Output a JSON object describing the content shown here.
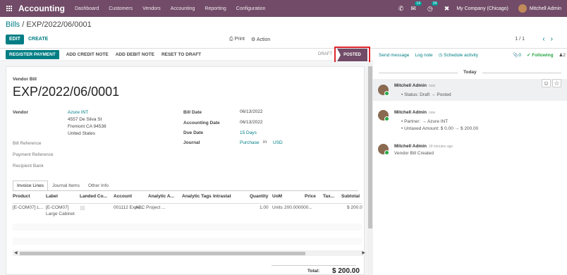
{
  "topbar": {
    "app_name": "Accounting",
    "menu": [
      "Dashboard",
      "Customers",
      "Vendors",
      "Accounting",
      "Reporting",
      "Configuration"
    ],
    "messages_count": "14",
    "activities_count": "34",
    "company": "My Company (Chicago)",
    "user": "Mitchell Admin"
  },
  "breadcrumb": {
    "parent": "Bills",
    "separator": " / ",
    "current": "EXP/2022/06/0001"
  },
  "control": {
    "edit_label": "EDIT",
    "create_label": "CREATE",
    "print_label": "Print",
    "action_label": "Action",
    "pager": "1 / 1"
  },
  "statusbar": {
    "buttons": [
      "REGISTER PAYMENT",
      "ADD CREDIT NOTE",
      "ADD DEBIT NOTE",
      "RESET TO DRAFT"
    ],
    "stage_draft": "DRAFT",
    "stage_posted": "POSTED"
  },
  "form": {
    "doc_type": "Vendor Bill",
    "doc_name": "EXP/2022/06/0001",
    "vendor_label": "Vendor",
    "vendor_name": "Azure INT",
    "vendor_address": [
      "4557 De Silva St",
      "Fremont CA 94538",
      "United States"
    ],
    "bill_reference_label": "Bill Reference",
    "payment_reference_label": "Payment Reference",
    "recipient_bank_label": "Recipient Bank",
    "bill_date_label": "Bill Date",
    "bill_date": "06/13/2022",
    "accounting_date_label": "Accounting Date",
    "accounting_date": "06/13/2022",
    "due_date_label": "Due Date",
    "due_date": "15 Days",
    "journal_label": "Journal",
    "journal": "Purchase",
    "journal_in": "in",
    "currency": "USD"
  },
  "tabs": [
    "Invoice Lines",
    "Journal Items",
    "Other Info"
  ],
  "table": {
    "headers": [
      "Product",
      "Label",
      "Landed Co...",
      "Account",
      "Analytic A...",
      "Analytic Tags",
      "Intrastat",
      "Quantity",
      "UoM",
      "Price",
      "Tax...",
      "Subtotal"
    ],
    "row": {
      "product": "[E-COM07] L...",
      "label_line1": "[E-COM07]",
      "label_line2": "Large Cabinet",
      "account": "001112 Expe...",
      "analytic": "ABC Project ...",
      "quantity": "1.00",
      "uom": "Units",
      "price": "200.000000...",
      "subtotal": "$ 200.0"
    }
  },
  "total": {
    "label": "Total:",
    "value": "$ 200.00"
  },
  "chatter": {
    "send_message": "Send message",
    "log_note": "Log note",
    "schedule_activity": "Schedule activity",
    "attachments": "0",
    "following": "Following",
    "followers": "2",
    "today": "Today",
    "messages": [
      {
        "author": "Mitchell Admin",
        "time": "now",
        "lines": [
          "Status: Draft → Posted"
        ]
      },
      {
        "author": "Mitchell Admin",
        "time": "now",
        "lines": [
          "Partner: → Azure INT",
          "Untaxed Amount: $ 0.00 → $ 200.00"
        ]
      },
      {
        "author": "Mitchell Admin",
        "time": "18 minutes ago",
        "lines": [
          "Vendor Bill Created"
        ]
      }
    ]
  },
  "colors": {
    "brand": "#714b67",
    "accent": "#017e84",
    "highlight": "#e0262c"
  }
}
